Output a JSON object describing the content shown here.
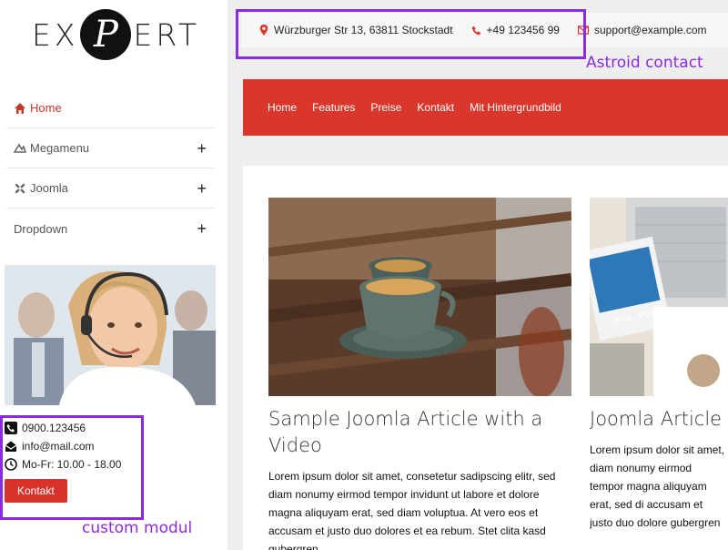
{
  "logo": {
    "text_left": "EX",
    "mark_letter": "P",
    "text_right": "ERT"
  },
  "sidebar": {
    "menu": [
      {
        "label": "Home",
        "icon": "home-icon",
        "active": true,
        "expandable": false
      },
      {
        "label": "Megamenu",
        "icon": "megamenu-icon",
        "active": false,
        "expandable": true
      },
      {
        "label": "Joomla",
        "icon": "joomla-icon",
        "active": false,
        "expandable": true
      },
      {
        "label": "Dropdown",
        "icon": "",
        "active": false,
        "expandable": true
      }
    ],
    "expand_symbol": "+",
    "contact": {
      "phone": "0900.123456",
      "email": "info@mail.com",
      "hours": "Mo-Fr: 10.00 - 18.00",
      "button_label": "Kontakt"
    }
  },
  "topbar": {
    "address": "Würzburger Str 13, 63811 Stockstadt",
    "phone": "+49 123456 99",
    "email": "support@example.com"
  },
  "nav": [
    "Home",
    "Features",
    "Preise",
    "Kontakt",
    "Mit Hintergrundbild"
  ],
  "articles": [
    {
      "title": "Sample Joomla Article with a Video",
      "body": "Lorem ipsum dolor sit amet, consetetur sadipscing elitr, sed diam nonumy eirmod tempor invidunt ut labore et dolore magna aliquyam erat, sed diam voluptua. At vero eos et accusam et justo duo dolores et ea rebum. Stet clita kasd gubergren"
    },
    {
      "title": "Joomla Article w",
      "body": "Lorem ipsum dolor sit amet, diam nonumy eirmod tempor magna aliquyam erat, sed di accusam et justo duo dolore gubergren"
    }
  ],
  "annotations": {
    "astroid_contact": "Astroid contact",
    "custom_modul": "custom modul"
  },
  "colors": {
    "accent_red": "#d9372c",
    "annotation_purple": "#8a2be2"
  }
}
